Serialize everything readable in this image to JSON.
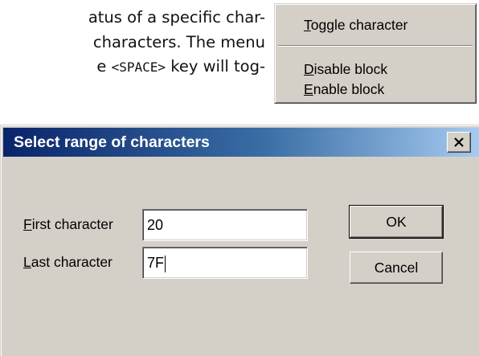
{
  "document": {
    "line1": "atus of a specific char-",
    "line2": " characters. The menu",
    "line3_pre": "e ",
    "line3_key": "<SPACE>",
    "line3_post": " key will tog-"
  },
  "context_menu": {
    "items": [
      {
        "accel": "T",
        "rest": "oggle character"
      },
      {
        "accel": "D",
        "rest": "isable block"
      },
      {
        "accel": "E",
        "rest": "nable block"
      }
    ]
  },
  "dialog": {
    "title": "Select range of characters",
    "first_label_accel": "F",
    "first_label_rest": "irst character",
    "first_value": "20",
    "last_label_accel": "L",
    "last_label_rest": "ast character",
    "last_value": "7F",
    "ok_label": "OK",
    "cancel_label": "Cancel"
  },
  "icons": {
    "close": "close-icon"
  },
  "colors": {
    "face": "#d4d0c8",
    "title_start": "#0a246a",
    "title_end": "#a6caf0"
  }
}
